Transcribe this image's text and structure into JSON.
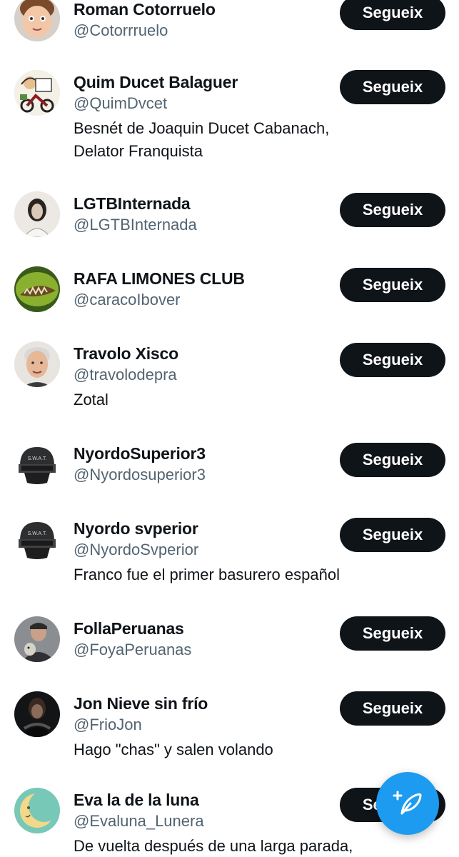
{
  "follow_label": "Segueix",
  "accounts": [
    {
      "name": "Roman Cotorruelo",
      "handle": "@Cotorrruelo",
      "bio": ""
    },
    {
      "name": "Quim Ducet Balaguer",
      "handle": "@QuimDvcet",
      "bio": "Besnét de Joaquin Ducet Cabanach,",
      "bio2": "Delator Franquista"
    },
    {
      "name": "LGTBInternada",
      "handle": "@LGTBInternada",
      "bio": ""
    },
    {
      "name": "RAFA LIMONES CLUB",
      "handle": "@caracoIbover",
      "bio": ""
    },
    {
      "name": "Travolo Xisco",
      "handle": "@travolodepra",
      "bio": "Zotal"
    },
    {
      "name": "NyordoSuperior3",
      "handle": "@Nyordosuperior3",
      "bio": ""
    },
    {
      "name": "Nyordo svperior",
      "handle": "@NyordoSvperior",
      "bio": "Franco fue el primer basurero español"
    },
    {
      "name": "FollaPeruanas",
      "handle": "@FoyaPeruanas",
      "bio": ""
    },
    {
      "name": "Jon Nieve sin frío",
      "handle": "@FrioJon",
      "bio": "Hago \"chas\" y salen volando"
    },
    {
      "name": "Eva la de la luna",
      "handle": "@Evaluna_Lunera",
      "bio": "De vuelta después de una larga parada,"
    }
  ],
  "avatar_text": {
    "swat": "S.W.A.T."
  },
  "colors": {
    "accent": "#1d9bf0",
    "button_bg": "#0f1419",
    "handle": "#536471"
  },
  "icons": {
    "compose": "feather-plus-icon"
  }
}
